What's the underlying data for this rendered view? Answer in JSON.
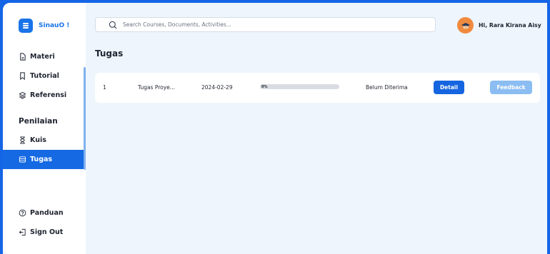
{
  "brand": {
    "name": "SinauO !"
  },
  "nav": {
    "items": [
      {
        "label": "Materi",
        "icon": "file-icon"
      },
      {
        "label": "Tutorial",
        "icon": "bookmark-icon"
      },
      {
        "label": "Referensi",
        "icon": "layers-icon"
      }
    ],
    "section_label": "Penilaian",
    "assessment_items": [
      {
        "label": "Kuis",
        "icon": "hourglass-icon"
      },
      {
        "label": "Tugas",
        "icon": "archive-icon",
        "active": true
      }
    ],
    "footer_items": [
      {
        "label": "Panduan",
        "icon": "help-circle-icon"
      },
      {
        "label": "Sign Out",
        "icon": "sign-out-icon"
      }
    ]
  },
  "search": {
    "placeholder": "Search Courses, Documents, Activities..."
  },
  "user": {
    "greeting": "Hi, Rara Kirana Aisya..."
  },
  "page": {
    "title": "Tugas"
  },
  "assignments": [
    {
      "no": "1",
      "name": "Tugas Proye...",
      "date": "2024-02-29",
      "progress_text": "0%",
      "progress_value": 0,
      "status": "Belum Diterima",
      "detail_label": "Detail",
      "feedback_label": "Feedback"
    }
  ],
  "colors": {
    "primary": "#1a73e8",
    "active_nav": "#1569e3",
    "feedback_disabled": "#8bbdf2",
    "background": "#eef5fd",
    "avatar": "#f08a3e"
  }
}
